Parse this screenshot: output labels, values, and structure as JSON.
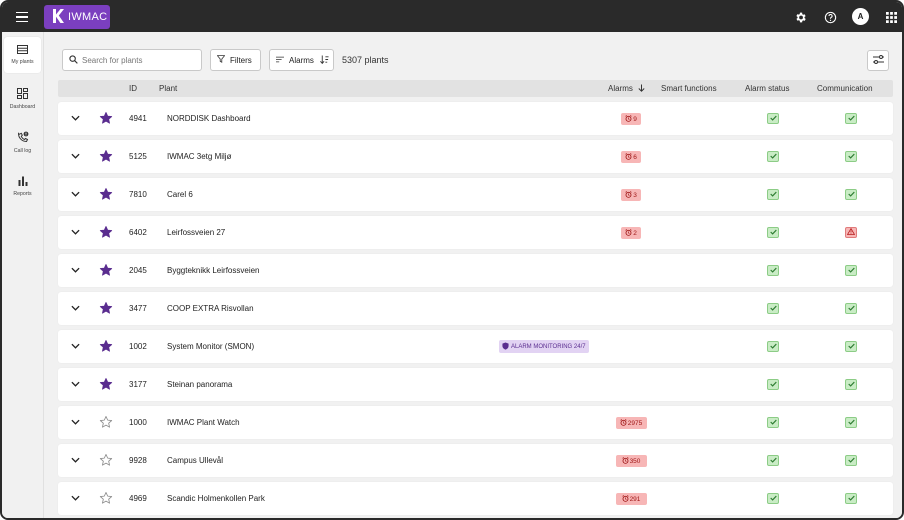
{
  "header": {
    "brand": "IWMAC",
    "avatar_initial": "A",
    "colors": {
      "topbar": "#2a2a2a",
      "brand": "#7b3fbf"
    }
  },
  "sidebar": {
    "items": [
      {
        "label": "My plants",
        "icon": "list-icon",
        "active": true
      },
      {
        "label": "Dashboard",
        "icon": "dashboard-icon",
        "active": false
      },
      {
        "label": "Call log",
        "icon": "phone-alert-icon",
        "active": false
      },
      {
        "label": "Reports",
        "icon": "bar-chart-icon",
        "active": false
      }
    ]
  },
  "toolbar": {
    "search_placeholder": "Search for plants",
    "filters_label": "Filters",
    "sort_label": "Alarms",
    "plant_count": "5307 plants"
  },
  "table": {
    "columns": {
      "id": "ID",
      "plant": "Plant",
      "alarms": "Alarms",
      "smart": "Smart functions",
      "alarm_status": "Alarm status",
      "communication": "Communication"
    },
    "rows": [
      {
        "id": "4941",
        "plant": "NORDDISK Dashboard",
        "favorite": true,
        "alarms": "9",
        "smart": "",
        "alarm_status": "ok",
        "communication": "ok"
      },
      {
        "id": "5125",
        "plant": "IWMAC 3etg Miljø",
        "favorite": true,
        "alarms": "6",
        "smart": "",
        "alarm_status": "ok",
        "communication": "ok"
      },
      {
        "id": "7810",
        "plant": "Carel 6",
        "favorite": true,
        "alarms": "3",
        "smart": "",
        "alarm_status": "ok",
        "communication": "ok"
      },
      {
        "id": "6402",
        "plant": "Leirfossveien 27",
        "favorite": true,
        "alarms": "2",
        "smart": "",
        "alarm_status": "ok",
        "communication": "warning"
      },
      {
        "id": "2045",
        "plant": "Byggteknikk Leirfossveien",
        "favorite": true,
        "alarms": "",
        "smart": "",
        "alarm_status": "ok",
        "communication": "ok"
      },
      {
        "id": "3477",
        "plant": "COOP EXTRA Risvollan",
        "favorite": true,
        "alarms": "",
        "smart": "",
        "alarm_status": "ok",
        "communication": "ok"
      },
      {
        "id": "1002",
        "plant": "System Monitor (SMON)",
        "favorite": true,
        "alarms": "",
        "smart": "ALARM MONITORING 24/7",
        "alarm_status": "ok",
        "communication": "ok"
      },
      {
        "id": "3177",
        "plant": "Steinan panorama",
        "favorite": true,
        "alarms": "",
        "smart": "",
        "alarm_status": "ok",
        "communication": "ok"
      },
      {
        "id": "1000",
        "plant": "IWMAC Plant Watch",
        "favorite": false,
        "alarms": "2975",
        "smart": "",
        "alarm_status": "ok",
        "communication": "ok"
      },
      {
        "id": "9928",
        "plant": "Campus Ullevål",
        "favorite": false,
        "alarms": "350",
        "smart": "",
        "alarm_status": "ok",
        "communication": "ok"
      },
      {
        "id": "4969",
        "plant": "Scandic Holmenkollen Park",
        "favorite": false,
        "alarms": "291",
        "smart": "",
        "alarm_status": "ok",
        "communication": "ok"
      }
    ]
  }
}
